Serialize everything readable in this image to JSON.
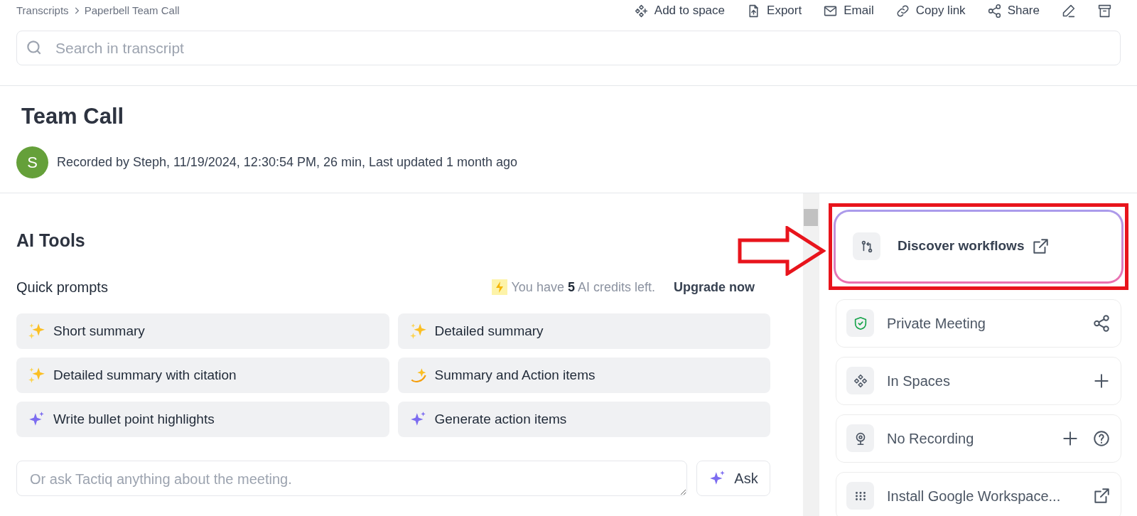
{
  "breadcrumb": [
    "Transcripts",
    "Paperbell Team Call"
  ],
  "toolbar": [
    {
      "kind": "space",
      "label": "Add to space"
    },
    {
      "kind": "export",
      "label": "Export"
    },
    {
      "kind": "email",
      "label": "Email"
    },
    {
      "kind": "link",
      "label": "Copy link"
    },
    {
      "kind": "share",
      "label": "Share"
    },
    {
      "kind": "edit"
    },
    {
      "kind": "archive"
    }
  ],
  "search": {
    "placeholder": "Search in transcript"
  },
  "meeting": {
    "title": "Team Call",
    "avatar": "S",
    "meta": "Recorded by Steph, 11/19/2024, 12:30:54 PM, 26 min, Last updated 1 month ago"
  },
  "ai_tools": {
    "title": "AI Tools",
    "subtitle": "Quick prompts",
    "credits": "You have **5** AI credits left.",
    "upgrade": "Upgrade now",
    "prompts": [
      {
        "kind": "sparkles",
        "label": "Short summary"
      },
      {
        "kind": "sparkles",
        "label": "Detailed summary"
      },
      {
        "kind": "sparkles",
        "label": "Detailed summary with citation"
      },
      {
        "kind": "dizzy",
        "label": "Summary and Action items"
      },
      {
        "kind": "ai",
        "label": "Write bullet point highlights"
      },
      {
        "kind": "ai",
        "label": "Generate action items"
      }
    ],
    "ask": {
      "placeholder": "Or ask Tactiq anything about the meeting.",
      "button": "Ask"
    }
  },
  "side_panel": [
    {
      "kind": "workflow",
      "label": "Discover workflows",
      "highlighted": true,
      "actions": [
        {
          "kind": "external"
        }
      ]
    },
    {
      "kind": "private",
      "label": "Private Meeting",
      "highlighted": false,
      "actions": [
        {
          "kind": "share"
        }
      ]
    },
    {
      "kind": "spaces",
      "label": "In Spaces",
      "highlighted": false,
      "actions": [
        {
          "kind": "add"
        }
      ]
    },
    {
      "kind": "recording",
      "label": "No Recording",
      "highlighted": false,
      "actions": [
        {
          "kind": "add"
        },
        {
          "kind": "help"
        }
      ]
    },
    {
      "kind": "apps",
      "label": "Install Google Workspace...",
      "highlighted": false,
      "actions": [
        {
          "kind": "external"
        }
      ]
    }
  ]
}
